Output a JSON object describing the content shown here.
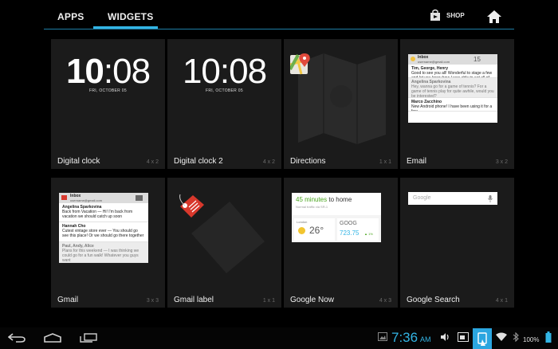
{
  "tabs": [
    {
      "label": "APPS",
      "active": false
    },
    {
      "label": "WIDGETS",
      "active": true
    }
  ],
  "shop_label": "SHOP",
  "accent_color": "#33b5e5",
  "widgets": [
    {
      "name": "Digital clock",
      "dims": "4 x 2",
      "clock_hour": "10",
      "clock_min": ":08",
      "date": "FRI, OCTOBER 05"
    },
    {
      "name": "Digital clock 2",
      "dims": "4 x 2",
      "clock_hour": "10",
      "clock_min": ":08",
      "date": "FRI, OCTOBER 05"
    },
    {
      "name": "Directions",
      "dims": "1 x 1"
    },
    {
      "name": "Email",
      "dims": "3 x 2",
      "preview": {
        "title": "Inbox",
        "account": "username@gmail.com",
        "count": "15",
        "rows": [
          {
            "from": "Tim, George, Henry",
            "text": "Good to see you all!  Wonderful to stage a few and let you know how I was able to eat all of you..."
          },
          {
            "from": "Angelina Sparkovina",
            "text": "Hey, wanna go for a game of tennis? For a game of tennis play for quite awhile, would you be interested?"
          },
          {
            "from": "Marco Zacchino",
            "text": "New Android phone!  I have been using it for a few..."
          }
        ]
      }
    },
    {
      "name": "Gmail",
      "dims": "3 x 3",
      "preview": {
        "title": "Inbox",
        "account": "username@gmail.com",
        "rows": [
          {
            "from": "Angelina Sparkovina",
            "text": "Back from Vacation — Hi! I'm back from vacation we should catch up soon"
          },
          {
            "from": "Hannah Cho",
            "text": "Cutest vintage store ever — You should go see this place! Or we should go there together"
          },
          {
            "from": "Paul, Andy, Alice",
            "text": "Plans for this weekend — I was thinking we could go for a fun walk! Whatever you guys want"
          }
        ]
      }
    },
    {
      "name": "Gmail label",
      "dims": "1 x 1"
    },
    {
      "name": "Google Now",
      "dims": "4 x 3",
      "preview": {
        "eta_minutes": "45 minutes",
        "eta_rest": " to home",
        "traffic": "Normal traffic via SR-1",
        "city": "London",
        "temp": "26°",
        "ticker": "GOOG",
        "price": "723.75",
        "change": "▲ 1%"
      }
    },
    {
      "name": "Google Search",
      "dims": "4 x 1",
      "search_placeholder": "Google"
    }
  ],
  "status": {
    "time": "7:36",
    "ampm": "AM",
    "battery": "100%"
  }
}
